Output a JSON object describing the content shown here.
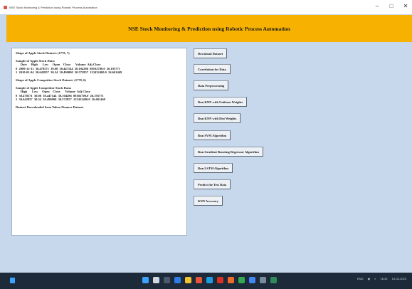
{
  "window": {
    "title": "NSE Stock Monitoring & Prediction using Robotic Process Automation",
    "controls": [
      "–",
      "□",
      "✕"
    ]
  },
  "header": {
    "title": "NSE Stock Monitoring & Prediction using Robotic Process Automation"
  },
  "output": {
    "lines": [
      "Shape of Apple Stock Dataset: (1770, 7)",
      "",
      "Sample of Apple Stock Data:",
      "      Date     High      Low     Open    Close      Volume  Adj Close",
      "0  2009-12-31  30.478571  30.08  30.447144  30.104286  88102700.0  26.193771",
      "1  2010-01-04  30.642857  30.34  30.490000  30.572857  123432400.0  26.601469",
      "",
      "Shape of Apple Competitor Stock Dataset: (1770, 6)",
      "",
      "Sample of Apple Competitor Stock Data:",
      "      High      Low     Open    Close      Volume  Adj Close",
      "0  30.478571  30.08  30.447144  30.104286  88102700.0  26.193771",
      "1  30.642857  30.34  30.490000  30.572857  123432400.0  26.601469",
      "",
      "Dataset Downloaded from Yahoo Finance Dataset"
    ]
  },
  "buttons": [
    {
      "label": "Download Dataset"
    },
    {
      "label": "Correlation for Data"
    },
    {
      "label": "Data Preprocessing"
    },
    {
      "label": "Run KNN with Uniform Weights"
    },
    {
      "label": "Run KNN with Dist Weights"
    },
    {
      "label": "Run SVM Algorithm"
    },
    {
      "label": "Run Gradient Boosting Regressor Algorithm"
    },
    {
      "label": "Run LSTM Algorithm"
    },
    {
      "label": "Predict the Test Data"
    },
    {
      "label": "KNN Accuracy"
    }
  ],
  "taskbar": {
    "tray_lang": "ENG",
    "tray_time": "16:40",
    "tray_date": "15-03-2023"
  },
  "colors": {
    "banner": "#f7b100",
    "background": "#c8d8ec",
    "taskbar": "#1c2a3a"
  }
}
